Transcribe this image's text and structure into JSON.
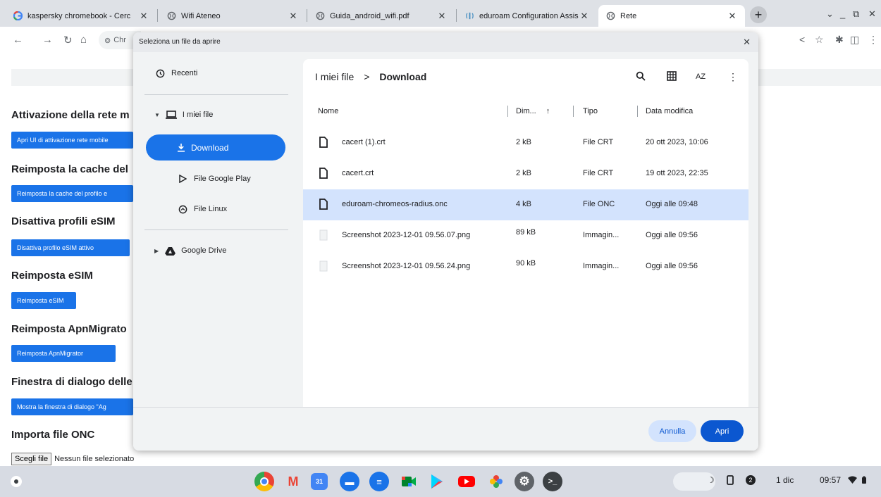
{
  "tabs": [
    {
      "title": "kaspersky chromebook - Cerc",
      "icon": "google-icon"
    },
    {
      "title": "Wifi Ateneo",
      "icon": "globe-icon"
    },
    {
      "title": "Guida_android_wifi.pdf",
      "icon": "globe-icon"
    },
    {
      "title": "eduroam Configuration Assis",
      "icon": "eduroam-icon"
    },
    {
      "title": "Rete",
      "icon": "globe-icon"
    }
  ],
  "omnibox": {
    "text": "Chr"
  },
  "page": {
    "sections": [
      {
        "heading": "Attivazione della rete m",
        "button": "Apri UI di attivazione rete mobile"
      },
      {
        "heading": "Reimposta la cache del",
        "button": "Reimposta la cache del profilo e"
      },
      {
        "heading": "Disattiva profili eSIM",
        "button": "Disattiva profilo eSIM attivo"
      },
      {
        "heading": "Reimposta eSIM",
        "button": "Reimposta eSIM"
      },
      {
        "heading": "Reimposta ApnMigrato",
        "button": "Reimposta ApnMigrator"
      },
      {
        "heading": "Finestra di dialogo delle",
        "button": "Mostra la finestra di dialogo \"Ag"
      },
      {
        "heading": "Importa file ONC",
        "button": ""
      }
    ],
    "file_input": {
      "button": "Scegli file",
      "status": "Nessun file selezionato"
    }
  },
  "dialog": {
    "title": "Seleziona un file da aprire",
    "nav": {
      "recent": "Recenti",
      "my_files": "I miei file",
      "download": "Download",
      "google_play": "File Google Play",
      "linux": "File Linux",
      "drive": "Google Drive"
    },
    "breadcrumb": [
      "I miei file",
      "Download"
    ],
    "breadcrumb_sep": ">",
    "sort_label": "AZ",
    "columns": {
      "name": "Nome",
      "size": "Dim...",
      "size_sort": "↑",
      "type": "Tipo",
      "modified": "Data modifica"
    },
    "files": [
      {
        "name": "cacert (1).crt",
        "size": "2 kB",
        "type": "File CRT",
        "modified": "20 ott 2023, 10:06",
        "icon": "file-icon"
      },
      {
        "name": "cacert.crt",
        "size": "2 kB",
        "type": "File CRT",
        "modified": "19 ott 2023, 22:35",
        "icon": "file-icon"
      },
      {
        "name": "eduroam-chromeos-radius.onc",
        "size": "4 kB",
        "type": "File ONC",
        "modified": "Oggi alle 09:48",
        "icon": "file-icon",
        "selected": true
      },
      {
        "name": "Screenshot 2023-12-01 09.56.07.png",
        "size": "89 kB",
        "type": "Immagin...",
        "modified": "Oggi alle 09:56",
        "icon": "image-thumb-icon"
      },
      {
        "name": "Screenshot 2023-12-01 09.56.24.png",
        "size": "90 kB",
        "type": "Immagin...",
        "modified": "Oggi alle 09:56",
        "icon": "image-thumb-icon"
      }
    ],
    "cancel": "Annulla",
    "open": "Apri"
  },
  "shelf": {
    "apps": [
      "Chrome",
      "Gmail",
      "Calendar",
      "Files",
      "Messages",
      "Meet",
      "Play Store",
      "YouTube",
      "Photos",
      "Settings",
      "Terminal"
    ],
    "notification_count": "2",
    "date": "1 dic",
    "time": "09:57"
  },
  "colors": {
    "accent": "#1a73e8",
    "selected_row": "#d3e3fd",
    "dialog_bg": "#f1f3f4"
  }
}
